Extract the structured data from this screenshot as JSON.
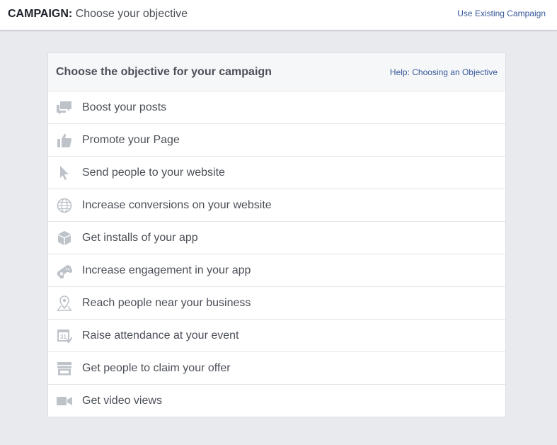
{
  "header": {
    "label_bold": "CAMPAIGN:",
    "label_rest": "Choose your objective",
    "use_existing_link": "Use Existing Campaign"
  },
  "panel": {
    "heading": "Choose the objective for your campaign",
    "help_link": "Help: Choosing an Objective"
  },
  "objectives": [
    {
      "label": "Boost your posts",
      "icon": "speech-bubbles-icon"
    },
    {
      "label": "Promote your Page",
      "icon": "thumbs-up-icon"
    },
    {
      "label": "Send people to your website",
      "icon": "cursor-arrow-icon"
    },
    {
      "label": "Increase conversions on your website",
      "icon": "globe-icon"
    },
    {
      "label": "Get installs of your app",
      "icon": "box-icon"
    },
    {
      "label": "Increase engagement in your app",
      "icon": "game-controller-icon"
    },
    {
      "label": "Reach people near your business",
      "icon": "map-pin-icon"
    },
    {
      "label": "Raise attendance at your event",
      "icon": "calendar-icon"
    },
    {
      "label": "Get people to claim your offer",
      "icon": "storefront-icon"
    },
    {
      "label": "Get video views",
      "icon": "video-camera-icon"
    }
  ],
  "colors": {
    "background": "#e9eaed",
    "link": "#365899",
    "text": "#4b4f56",
    "icon": "#bec3c9"
  }
}
